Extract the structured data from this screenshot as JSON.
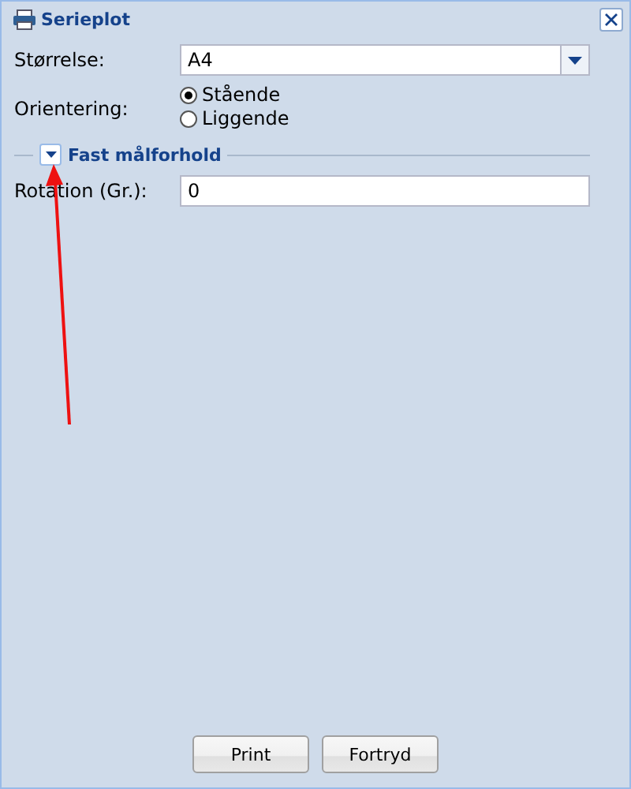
{
  "window": {
    "title": "Serieplot"
  },
  "size": {
    "label": "Størrelse:",
    "value": "A4"
  },
  "orientation": {
    "label": "Orientering:",
    "options": [
      {
        "label": "Stående",
        "selected": true
      },
      {
        "label": "Liggende",
        "selected": false
      }
    ]
  },
  "fieldset": {
    "title": "Fast målforhold",
    "expanded": true
  },
  "rotation": {
    "label": "Rotation (Gr.):",
    "value": "0"
  },
  "buttons": [
    "Print",
    "Fortryd"
  ]
}
